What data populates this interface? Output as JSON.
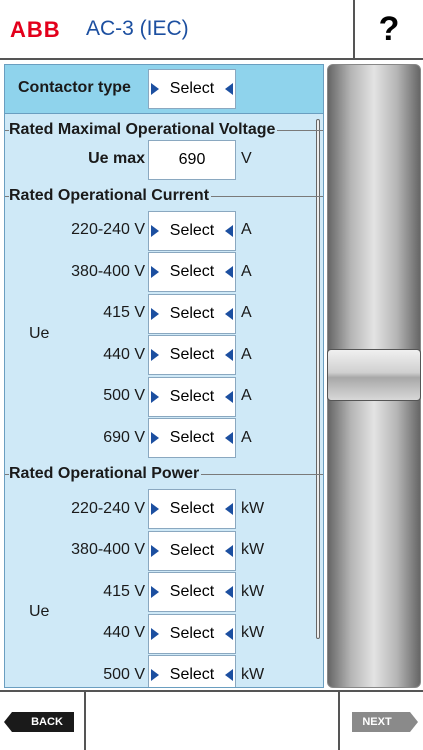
{
  "header": {
    "logo": "ABB",
    "title": "AC-3  (IEC)",
    "help": "?"
  },
  "contactor": {
    "label": "Contactor type",
    "value": "Select"
  },
  "voltage": {
    "section": "Rated Maximal Operational Voltage",
    "label": "Ue max",
    "value": "690",
    "unit": "V"
  },
  "current": {
    "section": "Rated Operational Current",
    "group_label": "Ue",
    "rows": [
      {
        "voltage": "220-240 V",
        "value": "Select",
        "unit": "A"
      },
      {
        "voltage": "380-400 V",
        "value": "Select",
        "unit": "A"
      },
      {
        "voltage": "415 V",
        "value": "Select",
        "unit": "A"
      },
      {
        "voltage": "440 V",
        "value": "Select",
        "unit": "A"
      },
      {
        "voltage": "500 V",
        "value": "Select",
        "unit": "A"
      },
      {
        "voltage": "690 V",
        "value": "Select",
        "unit": "A"
      }
    ]
  },
  "power": {
    "section": "Rated Operational Power",
    "group_label": "Ue",
    "rows": [
      {
        "voltage": "220-240 V",
        "value": "Select",
        "unit": "kW"
      },
      {
        "voltage": "380-400 V",
        "value": "Select",
        "unit": "kW"
      },
      {
        "voltage": "415 V",
        "value": "Select",
        "unit": "kW"
      },
      {
        "voltage": "440 V",
        "value": "Select",
        "unit": "kW"
      },
      {
        "voltage": "500 V",
        "value": "Select",
        "unit": "kW"
      }
    ]
  },
  "footer": {
    "back": "BACK",
    "next": "NEXT"
  }
}
